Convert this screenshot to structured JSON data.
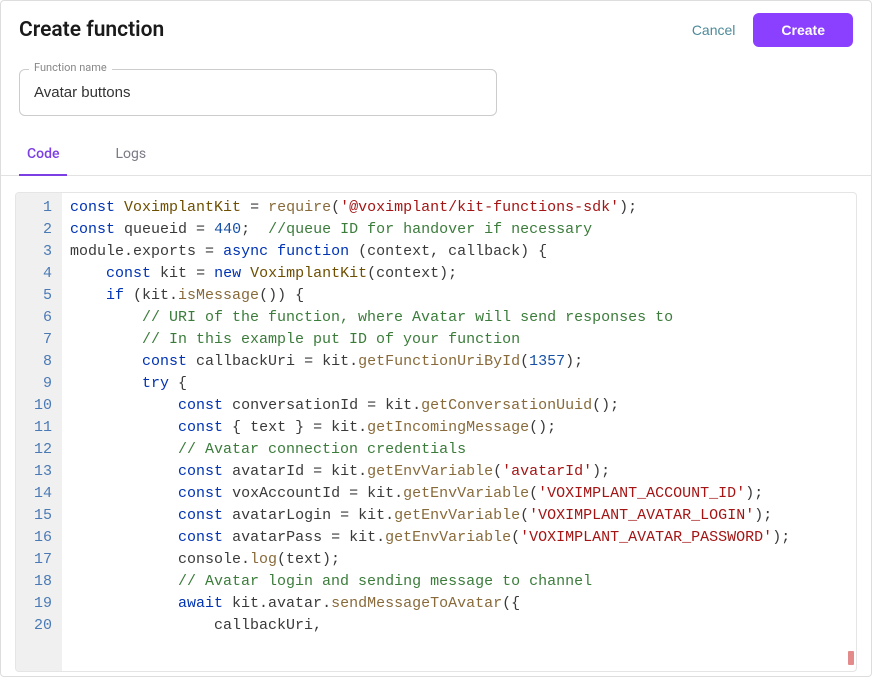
{
  "header": {
    "title": "Create function",
    "cancel": "Cancel",
    "create": "Create"
  },
  "field": {
    "label": "Function name",
    "value": "Avatar buttons"
  },
  "tabs": {
    "code": "Code",
    "logs": "Logs"
  },
  "code": {
    "lines": [
      [
        {
          "t": "kw",
          "v": "const"
        },
        {
          "t": "",
          "v": " "
        },
        {
          "t": "id",
          "v": "VoximplantKit"
        },
        {
          "t": "",
          "v": " = "
        },
        {
          "t": "fn",
          "v": "require"
        },
        {
          "t": "",
          "v": "("
        },
        {
          "t": "str",
          "v": "'@voximplant/kit-functions-sdk'"
        },
        {
          "t": "",
          "v": ");"
        }
      ],
      [
        {
          "t": "kw",
          "v": "const"
        },
        {
          "t": "",
          "v": " "
        },
        {
          "t": "def",
          "v": "queueid"
        },
        {
          "t": "",
          "v": " = "
        },
        {
          "t": "num",
          "v": "440"
        },
        {
          "t": "",
          "v": ";  "
        },
        {
          "t": "com",
          "v": "//queue ID for handover if necessary"
        }
      ],
      [
        {
          "t": "def",
          "v": "module"
        },
        {
          "t": "",
          "v": "."
        },
        {
          "t": "def",
          "v": "exports"
        },
        {
          "t": "",
          "v": " = "
        },
        {
          "t": "kw",
          "v": "async"
        },
        {
          "t": "",
          "v": " "
        },
        {
          "t": "kw",
          "v": "function"
        },
        {
          "t": "",
          "v": " (context, callback) {"
        }
      ],
      [
        {
          "t": "",
          "v": "    "
        },
        {
          "t": "kw",
          "v": "const"
        },
        {
          "t": "",
          "v": " "
        },
        {
          "t": "def",
          "v": "kit"
        },
        {
          "t": "",
          "v": " = "
        },
        {
          "t": "kw",
          "v": "new"
        },
        {
          "t": "",
          "v": " "
        },
        {
          "t": "id",
          "v": "VoximplantKit"
        },
        {
          "t": "",
          "v": "(context);"
        }
      ],
      [
        {
          "t": "",
          "v": "    "
        },
        {
          "t": "kw",
          "v": "if"
        },
        {
          "t": "",
          "v": " (kit."
        },
        {
          "t": "fn",
          "v": "isMessage"
        },
        {
          "t": "",
          "v": "()) {"
        }
      ],
      [
        {
          "t": "",
          "v": "        "
        },
        {
          "t": "com",
          "v": "// URI of the function, where Avatar will send responses to"
        }
      ],
      [
        {
          "t": "",
          "v": "        "
        },
        {
          "t": "com",
          "v": "// In this example put ID of your function"
        }
      ],
      [
        {
          "t": "",
          "v": "        "
        },
        {
          "t": "kw",
          "v": "const"
        },
        {
          "t": "",
          "v": " "
        },
        {
          "t": "def",
          "v": "callbackUri"
        },
        {
          "t": "",
          "v": " = kit."
        },
        {
          "t": "fn",
          "v": "getFunctionUriById"
        },
        {
          "t": "",
          "v": "("
        },
        {
          "t": "num",
          "v": "1357"
        },
        {
          "t": "",
          "v": ");"
        }
      ],
      [
        {
          "t": "",
          "v": "        "
        },
        {
          "t": "kw",
          "v": "try"
        },
        {
          "t": "",
          "v": " {"
        }
      ],
      [
        {
          "t": "",
          "v": "            "
        },
        {
          "t": "kw",
          "v": "const"
        },
        {
          "t": "",
          "v": " "
        },
        {
          "t": "def",
          "v": "conversationId"
        },
        {
          "t": "",
          "v": " = kit."
        },
        {
          "t": "fn",
          "v": "getConversationUuid"
        },
        {
          "t": "",
          "v": "();"
        }
      ],
      [
        {
          "t": "",
          "v": "            "
        },
        {
          "t": "kw",
          "v": "const"
        },
        {
          "t": "",
          "v": " { "
        },
        {
          "t": "def",
          "v": "text"
        },
        {
          "t": "",
          "v": " } = kit."
        },
        {
          "t": "fn",
          "v": "getIncomingMessage"
        },
        {
          "t": "",
          "v": "();"
        }
      ],
      [
        {
          "t": "",
          "v": "            "
        },
        {
          "t": "com",
          "v": "// Avatar connection credentials"
        }
      ],
      [
        {
          "t": "",
          "v": "            "
        },
        {
          "t": "kw",
          "v": "const"
        },
        {
          "t": "",
          "v": " "
        },
        {
          "t": "def",
          "v": "avatarId"
        },
        {
          "t": "",
          "v": " = kit."
        },
        {
          "t": "fn",
          "v": "getEnvVariable"
        },
        {
          "t": "",
          "v": "("
        },
        {
          "t": "str",
          "v": "'avatarId'"
        },
        {
          "t": "",
          "v": ");"
        }
      ],
      [
        {
          "t": "",
          "v": "            "
        },
        {
          "t": "kw",
          "v": "const"
        },
        {
          "t": "",
          "v": " "
        },
        {
          "t": "def",
          "v": "voxAccountId"
        },
        {
          "t": "",
          "v": " = kit."
        },
        {
          "t": "fn",
          "v": "getEnvVariable"
        },
        {
          "t": "",
          "v": "("
        },
        {
          "t": "str",
          "v": "'VOXIMPLANT_ACCOUNT_ID'"
        },
        {
          "t": "",
          "v": ");"
        }
      ],
      [
        {
          "t": "",
          "v": "            "
        },
        {
          "t": "kw",
          "v": "const"
        },
        {
          "t": "",
          "v": " "
        },
        {
          "t": "def",
          "v": "avatarLogin"
        },
        {
          "t": "",
          "v": " = kit."
        },
        {
          "t": "fn",
          "v": "getEnvVariable"
        },
        {
          "t": "",
          "v": "("
        },
        {
          "t": "str",
          "v": "'VOXIMPLANT_AVATAR_LOGIN'"
        },
        {
          "t": "",
          "v": ");"
        }
      ],
      [
        {
          "t": "",
          "v": "            "
        },
        {
          "t": "kw",
          "v": "const"
        },
        {
          "t": "",
          "v": " "
        },
        {
          "t": "def",
          "v": "avatarPass"
        },
        {
          "t": "",
          "v": " = kit."
        },
        {
          "t": "fn",
          "v": "getEnvVariable"
        },
        {
          "t": "",
          "v": "("
        },
        {
          "t": "str",
          "v": "'VOXIMPLANT_AVATAR_PASSWORD'"
        },
        {
          "t": "",
          "v": ");"
        }
      ],
      [
        {
          "t": "",
          "v": "            console."
        },
        {
          "t": "fn",
          "v": "log"
        },
        {
          "t": "",
          "v": "(text);"
        }
      ],
      [
        {
          "t": "",
          "v": "            "
        },
        {
          "t": "com",
          "v": "// Avatar login and sending message to channel"
        }
      ],
      [
        {
          "t": "",
          "v": "            "
        },
        {
          "t": "kw",
          "v": "await"
        },
        {
          "t": "",
          "v": " kit.avatar."
        },
        {
          "t": "fn",
          "v": "sendMessageToAvatar"
        },
        {
          "t": "",
          "v": "({"
        }
      ],
      [
        {
          "t": "",
          "v": "                callbackUri,"
        }
      ]
    ]
  }
}
